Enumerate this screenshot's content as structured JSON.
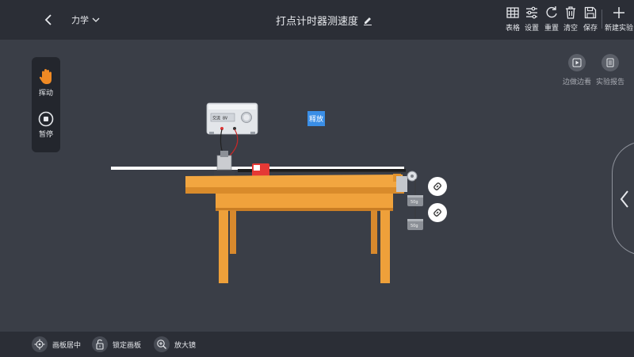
{
  "topbar": {
    "subject": "力学",
    "title": "打点计时器测速度",
    "tools": [
      {
        "icon": "table-icon",
        "label": "表格"
      },
      {
        "icon": "settings-icon",
        "label": "设置"
      },
      {
        "icon": "reset-icon",
        "label": "重置"
      },
      {
        "icon": "trash-icon",
        "label": "清空"
      },
      {
        "icon": "save-icon",
        "label": "保存"
      },
      {
        "icon": "plus-icon",
        "label": "新建实验"
      }
    ]
  },
  "left_panel": {
    "drag_label": "挥动",
    "pause_label": "暂停"
  },
  "right_tools": [
    {
      "icon": "play-icon",
      "label": "边做边看"
    },
    {
      "icon": "report-icon",
      "label": "实验报告"
    }
  ],
  "scene": {
    "release_label": "释放",
    "psu_display": "交流 8V",
    "weight_label_1": "50g",
    "weight_label_2": "50g"
  },
  "bottombar": {
    "center_label": "画板居中",
    "lock_label": "锁定画板",
    "zoom_label": "放大镜"
  },
  "colors": {
    "background": "#3a3e47",
    "bar": "#2b2e36",
    "accent_orange": "#f08a24",
    "release_blue": "#3a8ee6",
    "table_wood": "#f2a640"
  }
}
